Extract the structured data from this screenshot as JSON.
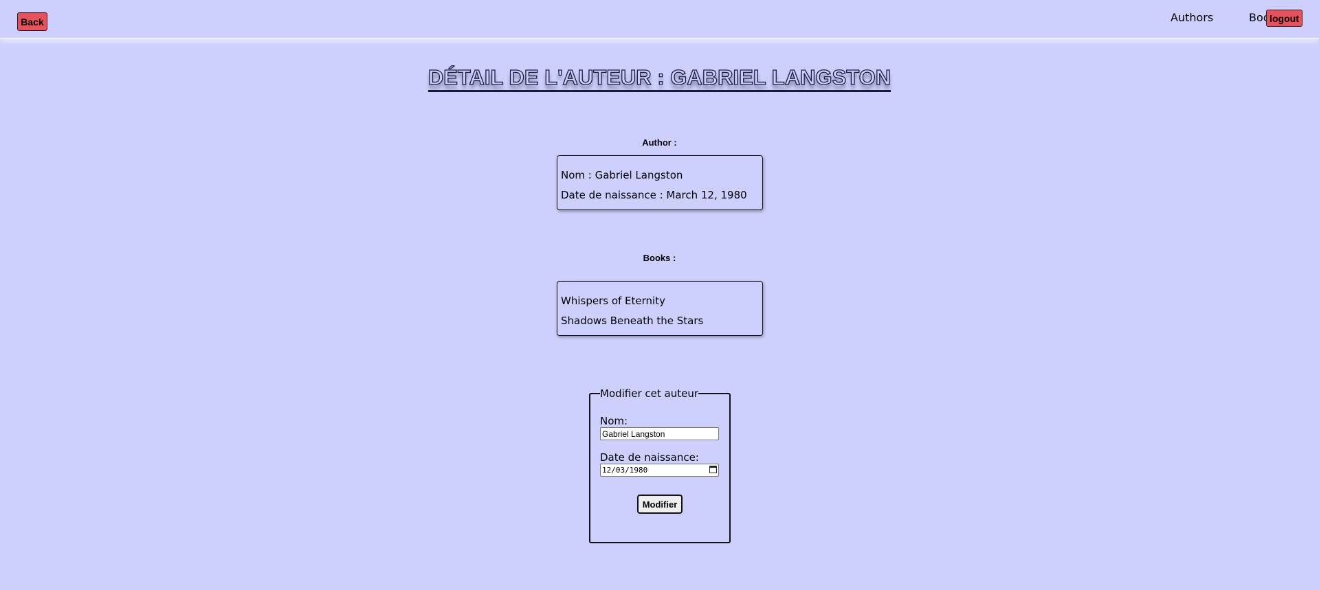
{
  "header": {
    "back_label": "Back",
    "nav": [
      {
        "label": "Authors"
      },
      {
        "label": "Book"
      }
    ],
    "logout_label": "logout"
  },
  "page": {
    "title": "DÉTAIL DE L'AUTEUR : GABRIEL LANGSTON"
  },
  "author_section": {
    "label": "Author :",
    "lines": [
      "Nom : Gabriel Langston",
      "Date de naissance : March 12, 1980"
    ]
  },
  "books_section": {
    "label": "Books :",
    "books": [
      "Whispers of Eternity",
      "Shadows Beneath the Stars"
    ]
  },
  "edit_form": {
    "legend": "Modifier cet auteur",
    "name_label": "Nom:",
    "name_value": "Gabriel Langston",
    "birth_label": "Date de naissance:",
    "birth_value": "12/03/1980",
    "submit_label": "Modifier"
  },
  "colors": {
    "background": "#cdd0fd",
    "accent_red": "#e8505b"
  }
}
